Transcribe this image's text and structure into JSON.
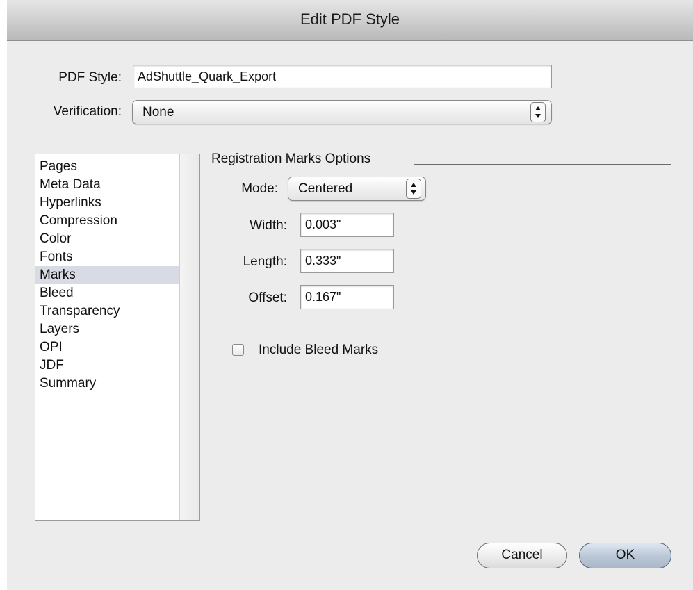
{
  "window": {
    "title": "Edit PDF Style"
  },
  "form": {
    "pdf_style_label": "PDF Style:",
    "pdf_style_value": "AdShuttle_Quark_Export",
    "verification_label": "Verification:",
    "verification_value": "None"
  },
  "sidebar": {
    "items": [
      {
        "label": "Pages"
      },
      {
        "label": "Meta Data"
      },
      {
        "label": "Hyperlinks"
      },
      {
        "label": "Compression"
      },
      {
        "label": "Color"
      },
      {
        "label": "Fonts"
      },
      {
        "label": "Marks",
        "selected": true
      },
      {
        "label": "Bleed"
      },
      {
        "label": "Transparency"
      },
      {
        "label": "Layers"
      },
      {
        "label": "OPI"
      },
      {
        "label": "JDF"
      },
      {
        "label": "Summary"
      }
    ]
  },
  "registration": {
    "group_title": "Registration Marks Options",
    "mode_label": "Mode:",
    "mode_value": "Centered",
    "width_label": "Width:",
    "width_value": "0.003\"",
    "length_label": "Length:",
    "length_value": "0.333\"",
    "offset_label": "Offset:",
    "offset_value": "0.167\"",
    "include_bleed_label": "Include Bleed Marks",
    "include_bleed_checked": false
  },
  "buttons": {
    "cancel": "Cancel",
    "ok": "OK"
  },
  "colors": {
    "selection": "#d8dbe3",
    "dialog_bg": "#ececec",
    "default_button": "#b9c6d6"
  }
}
